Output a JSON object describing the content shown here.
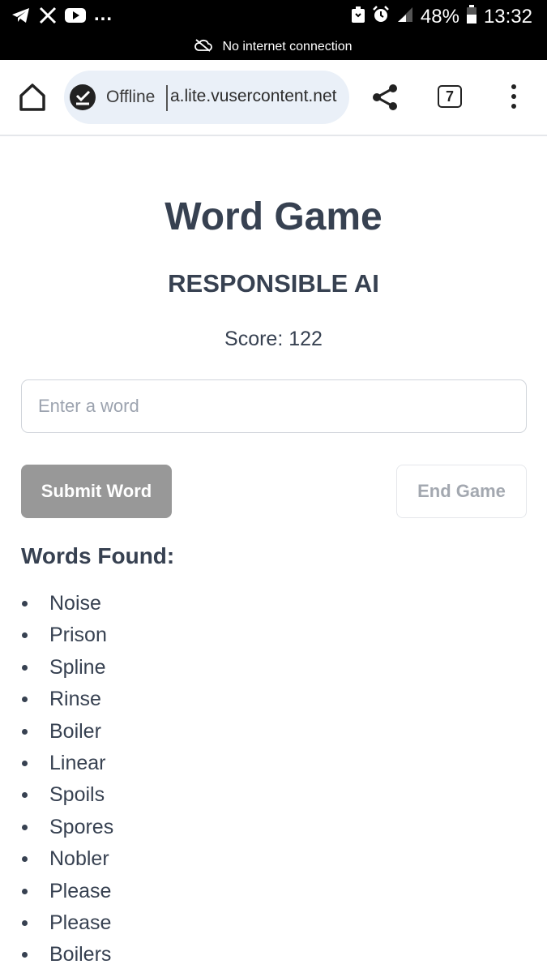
{
  "status_bar": {
    "battery": "48%",
    "time": "13:32",
    "notice": "No internet connection",
    "left_icons": [
      "telegram-icon",
      "x-icon",
      "youtube-icon"
    ],
    "right_icons": [
      "recycle-icon",
      "alarm-icon",
      "signal-icon",
      "battery-icon"
    ]
  },
  "browser": {
    "offline_label": "Offline",
    "url": "a.lite.vusercontent.net",
    "tab_count": "7"
  },
  "game": {
    "title": "Word Game",
    "subtitle": "RESPONSIBLE AI",
    "score": "Score: 122",
    "input_placeholder": "Enter a word",
    "input_value": "",
    "submit_label": "Submit Word",
    "end_label": "End Game",
    "words_heading": "Words Found:",
    "words": [
      "Noise",
      "Prison",
      "Spline",
      "Rinse",
      "Boiler",
      "Linear",
      "Spoils",
      "Spores",
      "Nobler",
      "Please",
      "Please",
      "Boilers"
    ]
  },
  "colors": {
    "text": "#374151",
    "submit_bg": "#989898",
    "urlbar_bg": "#eaf0f8"
  }
}
